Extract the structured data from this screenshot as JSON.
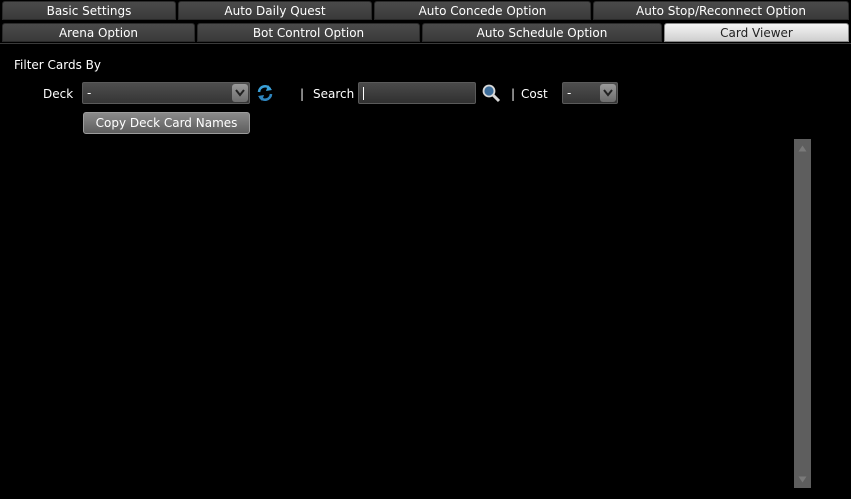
{
  "tabs": {
    "row1": [
      {
        "label": "Basic Settings"
      },
      {
        "label": "Auto Daily Quest"
      },
      {
        "label": "Auto Concede Option"
      },
      {
        "label": "Auto Stop/Reconnect Option"
      }
    ],
    "row2": [
      {
        "label": "Arena Option"
      },
      {
        "label": "Bot Control Option"
      },
      {
        "label": "Auto Schedule Option"
      },
      {
        "label": "Card Viewer",
        "active": true
      }
    ]
  },
  "filter": {
    "heading": "Filter Cards By",
    "deck_label": "Deck",
    "deck_value": "-",
    "separator": "|",
    "search_label": "Search",
    "search_value": "",
    "cost_label": "Cost",
    "cost_value": "-",
    "copy_button": "Copy Deck Card Names"
  },
  "icons": {
    "refresh": "refresh-icon",
    "search": "magnifier-icon",
    "dropdown": "chevron-down-icon"
  },
  "colors": {
    "background": "#000000",
    "active_tab": "#e6e6e6",
    "refresh_icon": "#3aa0d8"
  }
}
